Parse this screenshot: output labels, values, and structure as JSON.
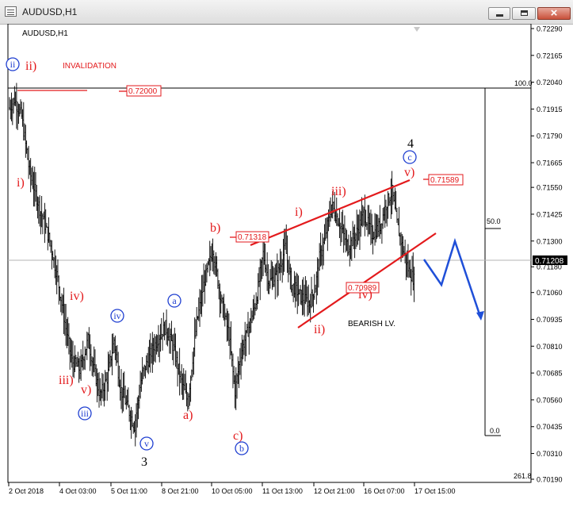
{
  "window": {
    "title": "AUDUSD,H1"
  },
  "chart_data": {
    "type": "candlestick",
    "symbol_label": "AUDUSD,H1",
    "price_axis": {
      "range": [
        0.7019,
        0.7229
      ],
      "ticks": [
        "0.72290",
        "0.72165",
        "0.72040",
        "0.71915",
        "0.71790",
        "0.71665",
        "0.71550",
        "0.71425",
        "0.71300",
        "0.71180",
        "0.71060",
        "0.70935",
        "0.70810",
        "0.70685",
        "0.70560",
        "0.70435",
        "0.70310",
        "0.70190"
      ]
    },
    "time_axis": {
      "labels": [
        "2 Oct 2018",
        "4 Oct 03:00",
        "5 Oct 11:00",
        "8 Oct 21:00",
        "10 Oct 05:00",
        "11 Oct 13:00",
        "12 Oct 21:00",
        "16 Oct 07:00",
        "17 Oct 15:00"
      ]
    },
    "price_path": [
      [
        0,
        0.7192
      ],
      [
        5,
        0.7196
      ],
      [
        12,
        0.7188
      ],
      [
        20,
        0.7162
      ],
      [
        30,
        0.7145
      ],
      [
        40,
        0.713
      ],
      [
        48,
        0.7112
      ],
      [
        55,
        0.7092
      ],
      [
        62,
        0.7074
      ],
      [
        70,
        0.707
      ],
      [
        78,
        0.7084
      ],
      [
        84,
        0.707
      ],
      [
        90,
        0.7058
      ],
      [
        97,
        0.7066
      ],
      [
        104,
        0.7084
      ],
      [
        110,
        0.7062
      ],
      [
        116,
        0.7054
      ],
      [
        124,
        0.7044
      ],
      [
        132,
        0.7068
      ],
      [
        140,
        0.7077
      ],
      [
        148,
        0.7085
      ],
      [
        155,
        0.709
      ],
      [
        163,
        0.708
      ],
      [
        170,
        0.7066
      ],
      [
        177,
        0.7055
      ],
      [
        186,
        0.7092
      ],
      [
        194,
        0.7112
      ],
      [
        202,
        0.7126
      ],
      [
        210,
        0.7103
      ],
      [
        218,
        0.7086
      ],
      [
        224,
        0.706
      ],
      [
        230,
        0.7078
      ],
      [
        238,
        0.709
      ],
      [
        245,
        0.7102
      ],
      [
        252,
        0.7124
      ],
      [
        258,
        0.7111
      ],
      [
        266,
        0.7114
      ],
      [
        274,
        0.7127
      ],
      [
        280,
        0.711
      ],
      [
        290,
        0.7104
      ],
      [
        298,
        0.7101
      ],
      [
        304,
        0.7109
      ],
      [
        308,
        0.7122
      ],
      [
        314,
        0.7132
      ],
      [
        320,
        0.7147
      ],
      [
        328,
        0.7138
      ],
      [
        336,
        0.7127
      ],
      [
        344,
        0.7133
      ],
      [
        352,
        0.7143
      ],
      [
        360,
        0.7133
      ],
      [
        368,
        0.7137
      ],
      [
        374,
        0.7147
      ],
      [
        380,
        0.7153
      ],
      [
        385,
        0.7138
      ],
      [
        390,
        0.7128
      ],
      [
        396,
        0.7117
      ],
      [
        402,
        0.7112
      ]
    ],
    "current_price": "0.71208",
    "price_level_boxes": [
      "0.72000",
      "0.71318",
      "0.70989",
      "0.71589"
    ],
    "fibonacci_levels": [
      "100.0",
      "50.0",
      "0.0",
      "261.8"
    ],
    "wave_labels": {
      "red": [
        "ii)",
        "i)",
        "iv)",
        "iii)",
        "v)",
        "b)",
        "a)",
        "c)",
        "i)",
        "iii)",
        "v)",
        "iv)",
        "ii)"
      ],
      "blue": [
        "ii",
        "iv",
        "iii",
        "v",
        "a",
        "b",
        "c"
      ],
      "black": [
        "3",
        "4"
      ]
    },
    "annotations": [
      "INVALIDATION",
      "BEARISH LV."
    ],
    "projection": "decline",
    "colors": {
      "candles": "#000000",
      "red_wave": "#e31a1c",
      "blue_wave": "#1f3fd1",
      "wedge": "#e31a1c",
      "projection": "#1f4fd8",
      "current_price_box": "#000000"
    }
  }
}
